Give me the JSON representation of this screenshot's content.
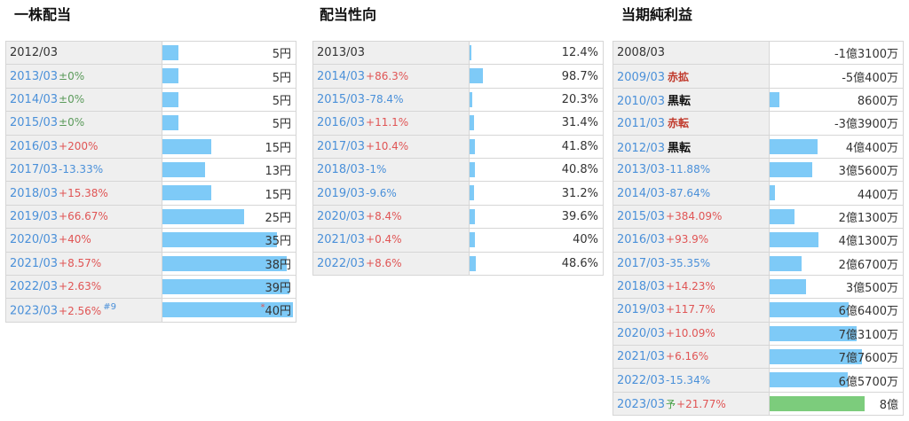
{
  "chart_data": [
    {
      "type": "bar",
      "title": "一株配当",
      "unit": "円",
      "max": 40,
      "rows": [
        {
          "year": "2012/03",
          "change": "",
          "value": 5,
          "display": "5円"
        },
        {
          "year": "2013/03",
          "change": "±0%",
          "value": 5,
          "display": "5円"
        },
        {
          "year": "2014/03",
          "change": "±0%",
          "value": 5,
          "display": "5円"
        },
        {
          "year": "2015/03",
          "change": "±0%",
          "value": 5,
          "display": "5円"
        },
        {
          "year": "2016/03",
          "change": "+200%",
          "value": 15,
          "display": "15円"
        },
        {
          "year": "2017/03",
          "change": "-13.33%",
          "value": 13,
          "display": "13円"
        },
        {
          "year": "2018/03",
          "change": "+15.38%",
          "value": 15,
          "display": "15円"
        },
        {
          "year": "2019/03",
          "change": "+66.67%",
          "value": 25,
          "display": "25円"
        },
        {
          "year": "2020/03",
          "change": "+40%",
          "value": 35,
          "display": "35円"
        },
        {
          "year": "2021/03",
          "change": "+8.57%",
          "value": 38,
          "display": "38円"
        },
        {
          "year": "2022/03",
          "change": "+2.63%",
          "value": 39,
          "display": "39円"
        },
        {
          "year": "2023/03",
          "change": "+2.56%",
          "value": 40,
          "display": "40円",
          "note": "#9",
          "star": "*"
        }
      ]
    },
    {
      "type": "bar",
      "title": "配当性向",
      "unit": "%",
      "max": 1000,
      "rows": [
        {
          "year": "2013/03",
          "change": "",
          "value": 12.4,
          "display": "12.4%"
        },
        {
          "year": "2014/03",
          "change": "+86.3%",
          "value": 98.7,
          "display": "98.7%"
        },
        {
          "year": "2015/03",
          "change": "-78.4%",
          "value": 20.3,
          "display": "20.3%"
        },
        {
          "year": "2016/03",
          "change": "+11.1%",
          "value": 31.4,
          "display": "31.4%"
        },
        {
          "year": "2017/03",
          "change": "+10.4%",
          "value": 41.8,
          "display": "41.8%"
        },
        {
          "year": "2018/03",
          "change": "-1%",
          "value": 40.8,
          "display": "40.8%"
        },
        {
          "year": "2019/03",
          "change": "-9.6%",
          "value": 31.2,
          "display": "31.2%"
        },
        {
          "year": "2020/03",
          "change": "+8.4%",
          "value": 39.6,
          "display": "39.6%"
        },
        {
          "year": "2021/03",
          "change": "+0.4%",
          "value": 40,
          "display": "40%"
        },
        {
          "year": "2022/03",
          "change": "+8.6%",
          "value": 48.6,
          "display": "48.6%"
        }
      ]
    },
    {
      "type": "bar",
      "title": "当期純利益",
      "unit": "円",
      "max": 110000,
      "rows": [
        {
          "year": "2008/03",
          "change": "",
          "value": -13100,
          "display": "-1億3100万"
        },
        {
          "year": "2009/03",
          "change": "",
          "tag": "赤拡",
          "tagStyle": "red",
          "value": -50400,
          "display": "-5億400万"
        },
        {
          "year": "2010/03",
          "change": "",
          "tag": "黒転",
          "tagStyle": "black",
          "value": 8600,
          "display": "8600万"
        },
        {
          "year": "2011/03",
          "change": "",
          "tag": "赤転",
          "tagStyle": "red",
          "value": -33900,
          "display": "-3億3900万"
        },
        {
          "year": "2012/03",
          "change": "",
          "tag": "黒転",
          "tagStyle": "black",
          "value": 40400,
          "display": "4億400万"
        },
        {
          "year": "2013/03",
          "change": "-11.88%",
          "value": 35600,
          "display": "3億5600万"
        },
        {
          "year": "2014/03",
          "change": "-87.64%",
          "value": 4400,
          "display": "4400万"
        },
        {
          "year": "2015/03",
          "change": "+384.09%",
          "value": 21300,
          "display": "2億1300万"
        },
        {
          "year": "2016/03",
          "change": "+93.9%",
          "value": 41300,
          "display": "4億1300万"
        },
        {
          "year": "2017/03",
          "change": "-35.35%",
          "value": 26700,
          "display": "2億6700万"
        },
        {
          "year": "2018/03",
          "change": "+14.23%",
          "value": 30500,
          "display": "3億500万"
        },
        {
          "year": "2019/03",
          "change": "+117.7%",
          "value": 66400,
          "display": "6億6400万"
        },
        {
          "year": "2020/03",
          "change": "+10.09%",
          "value": 73100,
          "display": "7億3100万"
        },
        {
          "year": "2021/03",
          "change": "+6.16%",
          "value": 77600,
          "display": "7億7600万"
        },
        {
          "year": "2022/03",
          "change": "-15.34%",
          "value": 65700,
          "display": "6億5700万"
        },
        {
          "year": "2023/03",
          "change": "+21.77%",
          "tag": "予",
          "tagStyle": "fc",
          "value": 80000,
          "display": "8億",
          "forecast": true
        }
      ]
    }
  ]
}
